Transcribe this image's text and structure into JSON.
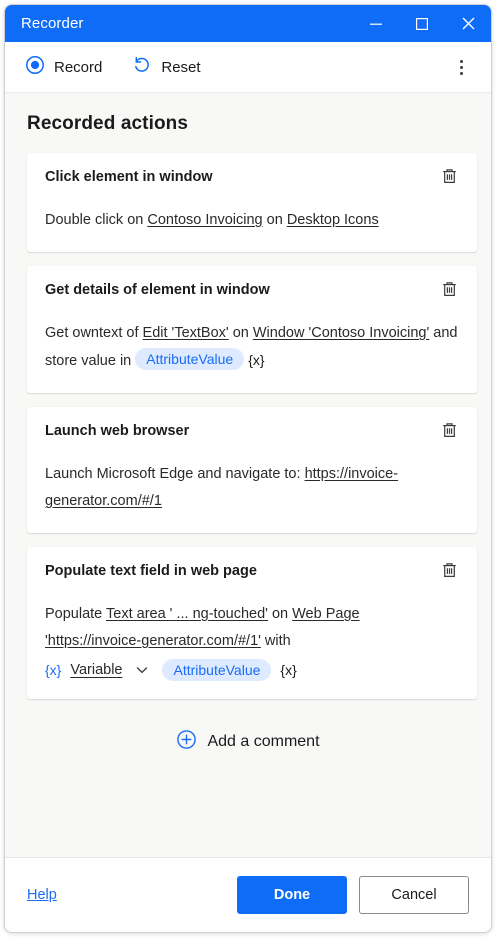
{
  "window": {
    "title": "Recorder",
    "controls": {
      "minimize": "minimize-icon",
      "maximize": "maximize-icon",
      "close": "close-icon"
    }
  },
  "toolbar": {
    "record_label": "Record",
    "record_icon": "record-circle-icon",
    "reset_label": "Reset",
    "reset_icon": "reset-undo-arrow-icon",
    "more_icon": "more-vertical-icon"
  },
  "main": {
    "section_title": "Recorded actions",
    "delete_icon": "trash-icon",
    "cards": [
      {
        "title": "Click element in window",
        "parts": [
          {
            "type": "text",
            "value": "Double click on "
          },
          {
            "type": "link",
            "value": "Contoso Invoicing"
          },
          {
            "type": "text",
            "value": " on "
          },
          {
            "type": "link",
            "value": "Desktop Icons"
          }
        ]
      },
      {
        "title": "Get details of element in window",
        "parts": [
          {
            "type": "text",
            "value": "Get owntext of "
          },
          {
            "type": "link",
            "value": "Edit 'TextBox'"
          },
          {
            "type": "text",
            "value": " on "
          },
          {
            "type": "link",
            "value": "Window 'Contoso Invoicing'"
          },
          {
            "type": "text",
            "value": " and store value in "
          },
          {
            "type": "pill",
            "value": "AttributeValue"
          },
          {
            "type": "token",
            "value": "{x}"
          }
        ]
      },
      {
        "title": "Launch web browser",
        "parts": [
          {
            "type": "text",
            "value": "Launch Microsoft Edge and navigate to: "
          },
          {
            "type": "link",
            "value": "https://invoice-generator.com/#/1"
          }
        ]
      },
      {
        "title": "Populate text field in web page",
        "parts": [
          {
            "type": "text",
            "value": "Populate "
          },
          {
            "type": "link",
            "value": "Text area ' ...  ng-touched'"
          },
          {
            "type": "text",
            "value": " on "
          },
          {
            "type": "link",
            "value": "Web Page 'https://invoice-generator.com/#/1'"
          },
          {
            "type": "text",
            "value": " with"
          }
        ],
        "variable_row": {
          "token_prefix": "{x}",
          "selector_label": "Variable",
          "chevron_icon": "chevron-down-icon",
          "pill": "AttributeValue",
          "token_suffix": "{x}"
        }
      }
    ],
    "add_comment": {
      "label": "Add a comment",
      "icon": "plus-circle-icon"
    }
  },
  "footer": {
    "help_label": "Help",
    "done_label": "Done",
    "cancel_label": "Cancel"
  },
  "colors": {
    "accent": "#0f6cf7",
    "link_blue": "#1a6cf5",
    "pill_bg": "#deeaff",
    "body_bg": "#f8f8f7",
    "card_bg": "#ffffff"
  }
}
